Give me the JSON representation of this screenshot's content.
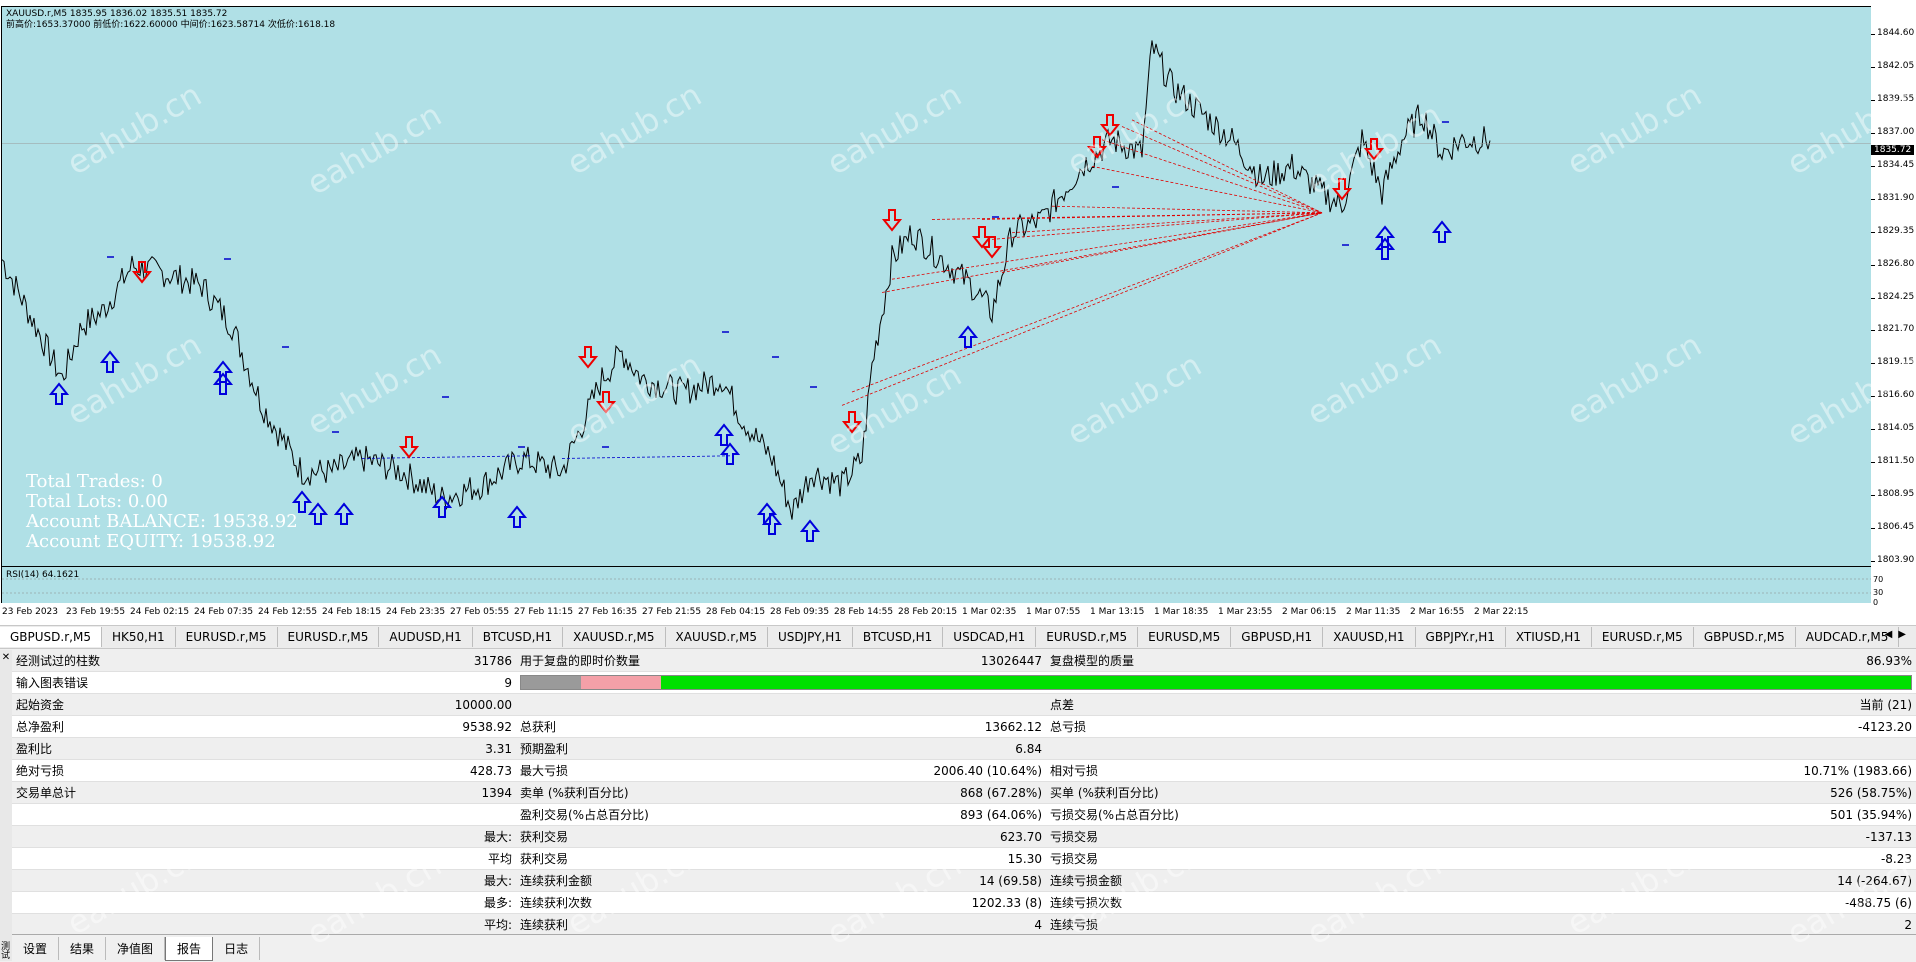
{
  "chart": {
    "header_line1": "XAUUSD.r,M5   1835.95 1836.02 1835.51 1835.72",
    "header_line2": "前高价:1653.37000 前低价:1622.60000 中间价:1623.58714 次低价:1618.18",
    "current_price": "1835.72",
    "price_ticks": [
      "1844.60",
      "1842.05",
      "1839.55",
      "1837.00",
      "1834.45",
      "1831.90",
      "1829.35",
      "1826.80",
      "1824.25",
      "1821.70",
      "1819.15",
      "1816.60",
      "1814.05",
      "1811.50",
      "1808.95",
      "1806.45",
      "1803.90"
    ],
    "time_ticks": [
      "23 Feb 2023",
      "23 Feb 19:55",
      "24 Feb 02:15",
      "24 Feb 07:35",
      "24 Feb 12:55",
      "24 Feb 18:15",
      "24 Feb 23:35",
      "27 Feb 05:55",
      "27 Feb 11:15",
      "27 Feb 16:35",
      "27 Feb 21:55",
      "28 Feb 04:15",
      "28 Feb 09:35",
      "28 Feb 14:55",
      "28 Feb 20:15",
      "1 Mar 02:35",
      "1 Mar 07:55",
      "1 Mar 13:15",
      "1 Mar 18:35",
      "1 Mar 23:55",
      "2 Mar 06:15",
      "2 Mar 11:35",
      "2 Mar 16:55",
      "2 Mar 22:15"
    ],
    "rsi_label": "RSI(14) 64.1621",
    "rsi_ticks": [
      "70",
      "30",
      "0"
    ],
    "overlay": {
      "total_trades": "Total Trades:  0",
      "total_lots": "Total Lots:  0.00",
      "balance": "Account BALANCE:  19538.92",
      "equity": "Account EQUITY:  19538.92"
    },
    "watermark": "eahub.cn",
    "colors": {
      "background": "#b0e0e6",
      "buy": "#0000dd",
      "sell": "#ee0000",
      "candles": "#000000"
    }
  },
  "symbol_tabs": [
    "GBPUSD.r,M5",
    "HK50,H1",
    "EURUSD.r,M5",
    "EURUSD.r,M5",
    "AUDUSD,H1",
    "BTCUSD,H1",
    "XAUUSD.r,M5",
    "XAUUSD.r,M5",
    "USDJPY,H1",
    "BTCUSD,H1",
    "USDCAD,H1",
    "EURUSD.r,M5",
    "EURUSD,M5",
    "GBPUSD,H1",
    "XAUUSD,H1",
    "GBPJPY.r,H1",
    "XTIUSD,H1",
    "EURUSD.r,M5",
    "GBPUSD.r,M5",
    "AUDCAD.r,M5"
  ],
  "report": {
    "rows": [
      [
        "经测试过的柱数",
        "31786",
        "用于复盘的即时价数量",
        "13026447",
        "复盘模型的质量",
        "86.93%"
      ],
      [
        "输入图表错误",
        "9",
        "",
        "",
        "",
        ""
      ],
      [
        "起始资金",
        "10000.00",
        "",
        "",
        "点差",
        "当前 (21)"
      ],
      [
        "总净盈利",
        "9538.92",
        "总获利",
        "13662.12",
        "总亏损",
        "-4123.20"
      ],
      [
        "盈利比",
        "3.31",
        "预期盈利",
        "6.84",
        "",
        ""
      ],
      [
        "绝对亏损",
        "428.73",
        "最大亏损",
        "2006.40 (10.64%)",
        "相对亏损",
        "10.71% (1983.66)"
      ],
      [
        "交易单总计",
        "1394",
        "卖单 (%获利百分比)",
        "868 (67.28%)",
        "买单 (%获利百分比)",
        "526 (58.75%)"
      ],
      [
        "",
        "",
        "盈利交易(%占总百分比)",
        "893 (64.06%)",
        "亏损交易(%占总百分比)",
        "501 (35.94%)"
      ],
      [
        "",
        "最大:",
        "获利交易",
        "623.70",
        "亏损交易",
        "-137.13"
      ],
      [
        "",
        "平均",
        "获利交易",
        "15.30",
        "亏损交易",
        "-8.23"
      ],
      [
        "",
        "最大:",
        "连续获利金额",
        "14 (69.58)",
        "连续亏损金额",
        "14 (-264.67)"
      ],
      [
        "",
        "最多:",
        "连续获利次数",
        "1202.33 (8)",
        "连续亏损次数",
        "-488.75 (6)"
      ],
      [
        "",
        "平均:",
        "连续获利",
        "4",
        "连续亏损",
        "2"
      ]
    ],
    "quality_bar": {
      "gray_fraction": 0.043,
      "pink_fraction": 0.058
    }
  },
  "bottom_tabs": [
    "设置",
    "结果",
    "净值图",
    "报告",
    "日志"
  ],
  "active_bottom_tab": "报告",
  "side_label": "测试"
}
